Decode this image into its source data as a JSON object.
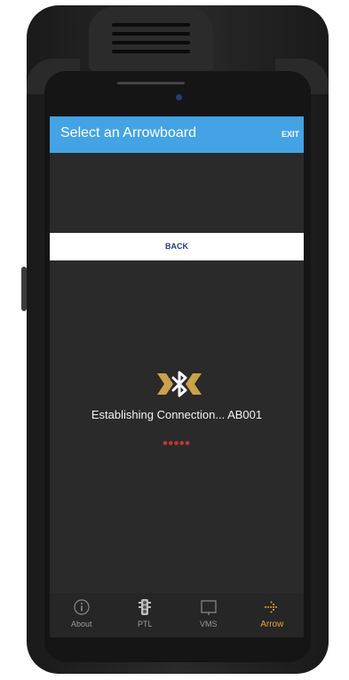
{
  "app_bar": {
    "title": "Select an Arrowboard",
    "exit_label": "EXIT"
  },
  "back_button": {
    "label": "BACK"
  },
  "connection": {
    "status_text": "Establishing Connection... AB001",
    "progress_dots": "●●●●●",
    "icon": "bluetooth-icon"
  },
  "bottom_nav": {
    "items": [
      {
        "label": "About",
        "icon": "info-icon",
        "active": false
      },
      {
        "label": "PTL",
        "icon": "traffic-light-icon",
        "active": false
      },
      {
        "label": "VMS",
        "icon": "vms-sign-icon",
        "active": false
      },
      {
        "label": "Arrow",
        "icon": "arrow-board-icon",
        "active": true
      }
    ]
  },
  "colors": {
    "app_bar": "#43a3e4",
    "screen_background": "#2a2a2a",
    "accent_active": "#e0a82e",
    "progress": "#c4362f",
    "back_text": "#2a3b7a"
  }
}
